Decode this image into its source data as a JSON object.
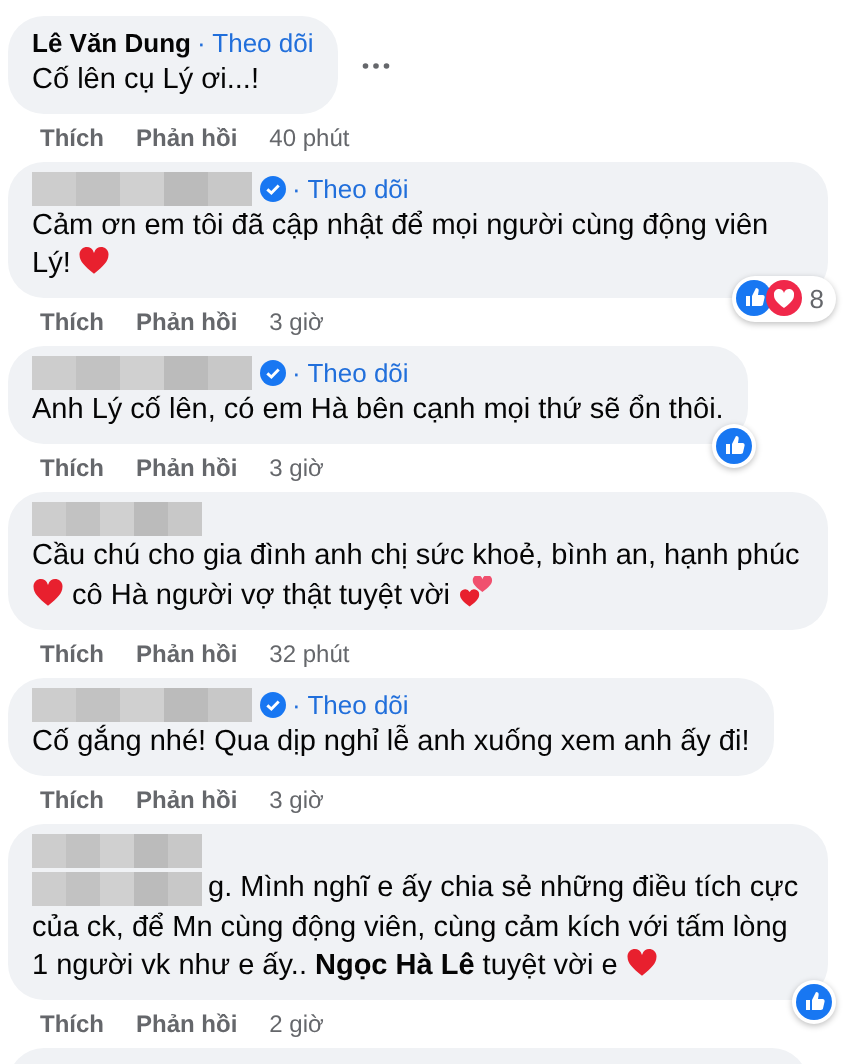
{
  "comments": [
    {
      "author": "Lê Văn Dung",
      "author_hidden": false,
      "verified": false,
      "follow": "· Theo dõi",
      "parts": [
        {
          "kind": "text",
          "text": "Cố lên cụ Lý ơi...!"
        }
      ],
      "has_menu": true,
      "actions": [
        "Thích",
        "Phản hồi"
      ],
      "time": "40 phút"
    },
    {
      "author_hidden": true,
      "verified": true,
      "follow": "· Theo dõi",
      "parts": [
        {
          "kind": "text",
          "text": "Cảm ơn em tôi đã cập nhật để mọi người cùng động viên Lý! "
        },
        {
          "kind": "heart"
        }
      ],
      "has_menu": false,
      "actions": [
        "Thích",
        "Phản hồi"
      ],
      "time": "3 giờ",
      "reactions": {
        "like": true,
        "love": true,
        "count": "8"
      }
    },
    {
      "author_hidden": true,
      "verified": true,
      "follow": "· Theo dõi",
      "parts": [
        {
          "kind": "text",
          "text": "Anh Lý cố lên, có em Hà bên cạnh mọi thứ sẽ ổn thôi."
        }
      ],
      "has_menu": false,
      "actions": [
        "Thích",
        "Phản hồi"
      ],
      "time": "3 giờ",
      "reactions": {
        "like": true,
        "love": false
      }
    },
    {
      "author_hidden": true,
      "verified": false,
      "parts": [
        {
          "kind": "text",
          "text": "Cầu chú cho gia đình anh chị sức khoẻ, bình an, hạnh phúc"
        },
        {
          "kind": "heart"
        },
        {
          "kind": "text",
          "text": " cô Hà người vợ thật tuyệt vời "
        },
        {
          "kind": "two_hearts"
        }
      ],
      "has_menu": false,
      "actions": [
        "Thích",
        "Phản hồi"
      ],
      "time": "32 phút"
    },
    {
      "author_hidden": true,
      "verified": true,
      "follow": "· Theo dõi",
      "parts": [
        {
          "kind": "text",
          "text": "Cố gắng nhé! Qua dịp nghỉ lễ anh xuống xem anh ấy đi!"
        }
      ],
      "has_menu": false,
      "actions": [
        "Thích",
        "Phản hồi"
      ],
      "time": "3 giờ"
    },
    {
      "author_hidden": true,
      "verified": false,
      "parts": [
        {
          "kind": "after_redacted",
          "text": "g. Mình nghĩ e ấy chia sẻ những điều tích cực"
        },
        {
          "kind": "text",
          "text": "của ck, để Mn cùng động viên, cùng cảm kích với tấm lòng 1 người vk như e ấy.. **Ngọc Hà Lê** tuyệt vời e "
        },
        {
          "kind": "heart"
        }
      ],
      "has_menu": false,
      "actions": [
        "Thích",
        "Phản hồi"
      ],
      "time": "2 giờ",
      "reactions": {
        "like": true,
        "love": false
      }
    }
  ]
}
